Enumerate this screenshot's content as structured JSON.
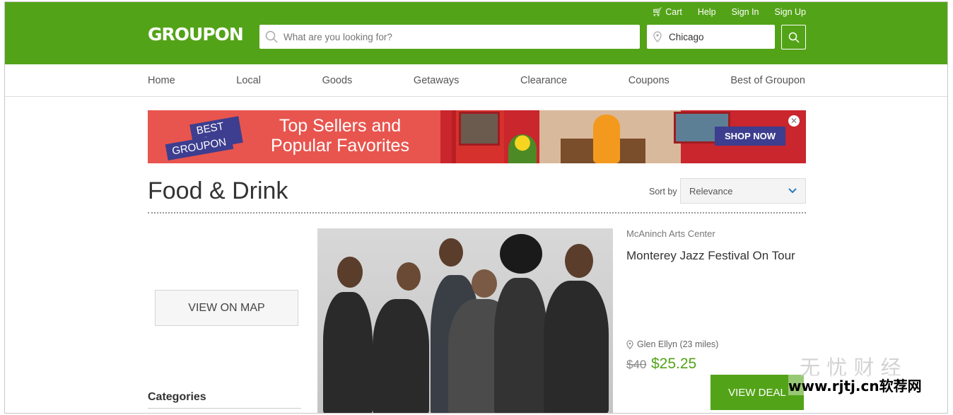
{
  "header": {
    "logo": "GROUPON",
    "top_links": [
      "Cart",
      "Help",
      "Sign In",
      "Sign Up"
    ],
    "search_placeholder": "What are you looking for?",
    "location_value": "Chicago",
    "brand_color": "#53a318"
  },
  "nav": {
    "items": [
      "Home",
      "Local",
      "Goods",
      "Getaways",
      "Clearance",
      "Coupons",
      "Best of Groupon"
    ]
  },
  "banner": {
    "badge_line1": "BEST of",
    "badge_line2": "GROUPON",
    "headline_line1": "Top Sellers and",
    "headline_line2": "Popular Favorites",
    "cta": "SHOP NOW",
    "close_icon": "✕"
  },
  "page": {
    "title": "Food & Drink",
    "sort_label": "Sort by",
    "sort_value": "Relevance"
  },
  "sidebar": {
    "map_button": "VIEW ON MAP",
    "categories_heading": "Categories"
  },
  "deal": {
    "merchant": "McAninch Arts Center",
    "title": "Monterey Jazz Festival On Tour",
    "location": "Glen Ellyn (23 miles)",
    "price_original": "$40",
    "price_deal": "$25.25",
    "cta": "VIEW DEAL"
  },
  "watermark": {
    "line1": "无 忧 财 经",
    "line2": "www.rjtj.cn软荐网"
  }
}
